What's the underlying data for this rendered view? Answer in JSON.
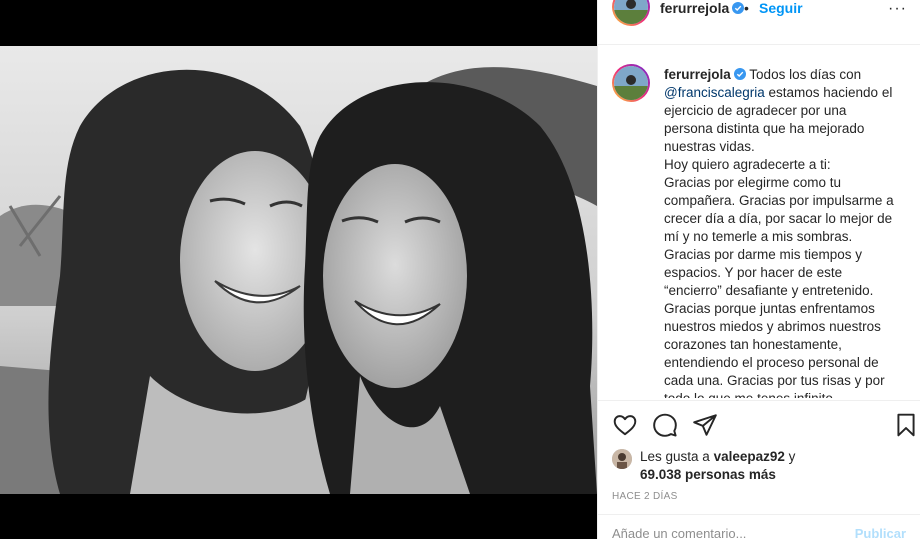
{
  "post": {
    "username": "ferurrejola",
    "follow_label": "Seguir",
    "separator": "•",
    "more_label": "···"
  },
  "caption": {
    "username": "ferurrejola",
    "lines": [
      "Todos los días con",
      "@franciscalegria estamos haciendo el",
      "ejercicio de agradecer por una",
      "persona distinta que ha mejorado",
      "nuestras vidas.",
      "Hoy quiero agradecerte a ti:",
      "Gracias por elegirme como tu",
      "compañera. Gracias por impulsarme a",
      "crecer día a día, por sacar lo mejor de",
      "mí y no temerle a mis sombras.",
      "Gracias por darme mis tiempos y",
      "espacios. Y por hacer de este",
      "“encierro” desafiante y entretenido.",
      "Gracias porque juntas enfrentamos",
      "nuestros miedos y abrimos nuestros",
      "corazones tan honestamente,",
      "entendiendo el proceso personal de",
      "cada una. Gracias por tus risas y por",
      "todo lo que me tenes infinito"
    ],
    "mention": "@franciscalegria"
  },
  "likes": {
    "prefix": "Les gusta a",
    "user": "valeepaz92",
    "conjunction": "y",
    "count_text": "69.038 personas más"
  },
  "time_label": "HACE 2 DÍAS",
  "comment": {
    "placeholder": "Añade un comentario...",
    "publish_label": "Publicar"
  },
  "icons": {
    "like": "heart-icon",
    "comment": "comment-icon",
    "share": "share-icon",
    "save": "bookmark-icon",
    "verified": "verified-badge-icon"
  },
  "colors": {
    "accent": "#0095f6",
    "verified": "#3897f0",
    "text": "#262626",
    "muted": "#8e8e8e"
  }
}
